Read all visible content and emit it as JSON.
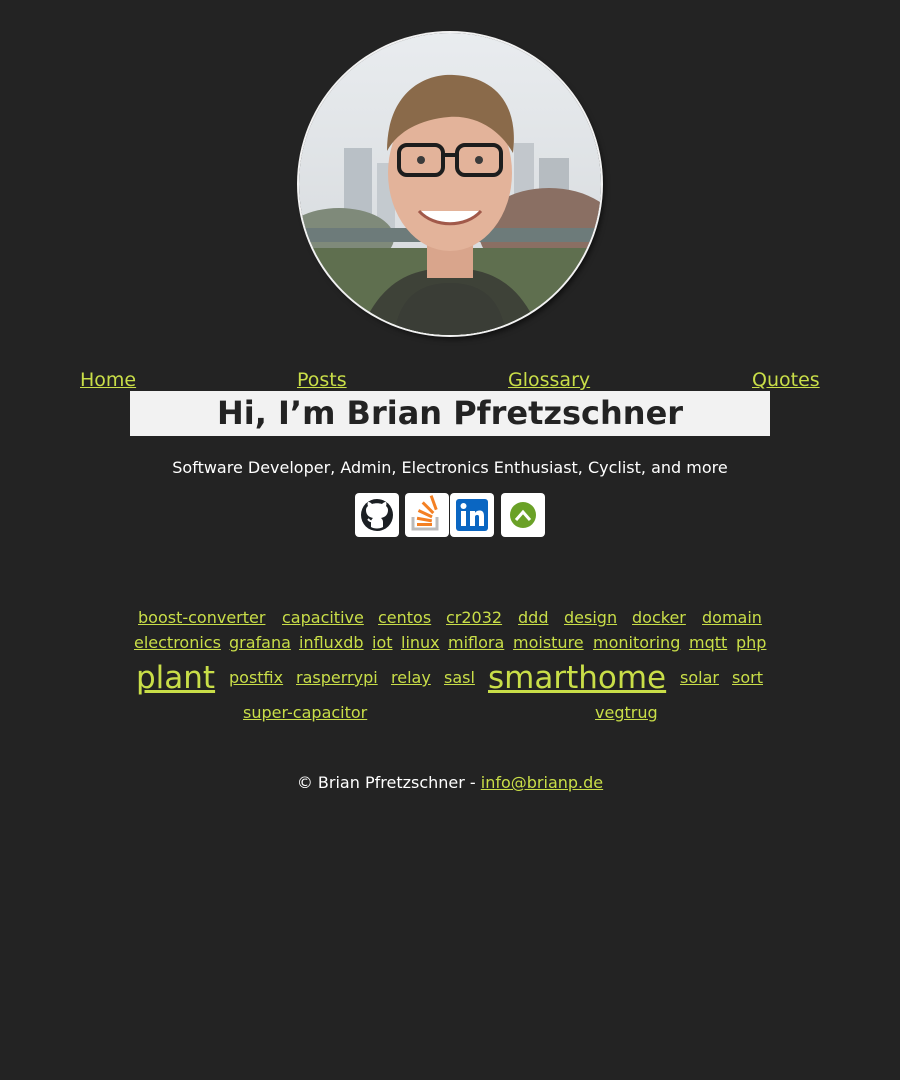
{
  "profile": {
    "avatar_label": "portrait photo"
  },
  "nav": {
    "home": "Home",
    "posts": "Posts",
    "glossary": "Glossary",
    "quotes": "Quotes"
  },
  "hero": {
    "title": "Hi, I’m Brian Pfretzschner",
    "subtitle": "Software Developer, Admin, Electronics Enthusiast, Cyclist, and more"
  },
  "social": [
    {
      "name": "github-icon",
      "color": "#1b1f23"
    },
    {
      "name": "stackoverflow-icon",
      "color": "#f48024"
    },
    {
      "name": "linkedin-icon",
      "color": "#0a66c2"
    },
    {
      "name": "komoot-icon",
      "color": "#6aa127"
    }
  ],
  "tags": {
    "boost_converter": "boost-converter",
    "capacitive": "capacitive",
    "centos": "centos",
    "cr2032": "cr2032",
    "ddd": "ddd",
    "design": "design",
    "docker": "docker",
    "domain": "domain",
    "electronics": "electronics",
    "grafana": "grafana",
    "influxdb": "influxdb",
    "iot": "iot",
    "linux": "linux",
    "miflora": "miflora",
    "moisture": "moisture",
    "monitoring": "monitoring",
    "mqtt": "mqtt",
    "php": "php",
    "plant": "plant",
    "postfix": "postfix",
    "rasperrypi": "rasperrypi",
    "relay": "relay",
    "sasl": "sasl",
    "smarthome": "smarthome",
    "solar": "solar",
    "sort": "sort",
    "super_capacitor": "super-capacitor",
    "vegtrug": "vegtrug"
  },
  "footer": {
    "copyright": "© Brian Pfretzschner - ",
    "email": "info@brianp.de"
  },
  "colors": {
    "background": "#232323",
    "link": "#c9de48",
    "banner": "#f2f2f2",
    "text": "#ffffff"
  }
}
